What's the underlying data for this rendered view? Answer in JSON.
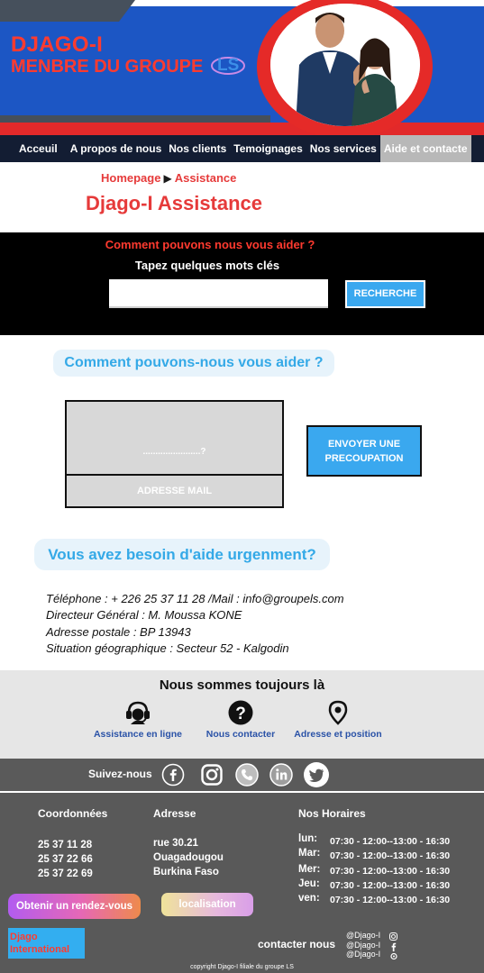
{
  "header": {
    "brand_line1": "DJAGO-I",
    "brand_line2": "MENBRE DU GROUPE",
    "logo_text": "LS",
    "colors": {
      "banner": "#1c56c4",
      "brand_red": "#ff3b2f",
      "accent_red": "#e2292a"
    }
  },
  "nav": {
    "items": [
      {
        "label": "Acceuil"
      },
      {
        "label": "A propos de nous"
      },
      {
        "label": "Nos clients"
      },
      {
        "label": "Temoignages"
      },
      {
        "label": "Nos services"
      },
      {
        "label": "Aide et contacte"
      }
    ],
    "active_index": 5
  },
  "breadcrumb": {
    "home": "Homepage",
    "current": "Assistance"
  },
  "page_title": "Djago-I Assistance",
  "search": {
    "question": "Comment pouvons nous vous aider ?",
    "hint": "Tapez quelques mots clés",
    "input_value": "",
    "button_label": "RECHERCHE"
  },
  "help": {
    "heading": "Comment pouvons-nous vous aider ?",
    "message_placeholder": ".......................?",
    "email_placeholder": "ADRESSE MAIL",
    "send_button": "ENVOYER UNE PRECOUPATION"
  },
  "urgent": {
    "heading": "Vous avez besoin d'aide urgenment?",
    "lines": [
      "Téléphone : + 226 25 37 11 28 /Mail : info@groupels.com",
      "Directeur Général : M. Moussa KONE",
      "Adresse postale : BP 13943",
      "Situation géographique : Secteur 52 - Kalgodin"
    ]
  },
  "always": {
    "title": "Nous sommes toujours là",
    "items": [
      {
        "label": "Assistance en ligne",
        "icon": "headset-icon"
      },
      {
        "label": "Nous contacter",
        "icon": "question-icon"
      },
      {
        "label": "Adresse et position",
        "icon": "map-pin-icon"
      }
    ]
  },
  "follow": {
    "label": "Suivez-nous",
    "icons": [
      "facebook-icon",
      "instagram-icon",
      "phone-icon",
      "linkedin-icon",
      "twitter-icon"
    ]
  },
  "footer": {
    "coords_title": "Coordonnées",
    "coords": [
      "25 37 11 28",
      "25 37 22 66",
      "25 37 22 69"
    ],
    "address_title": "Adresse",
    "address": [
      "rue 30.21",
      "Ouagadougou",
      "Burkina Faso"
    ],
    "hours_title": "Nos Horaires",
    "hours": [
      {
        "day": "lun:",
        "time": "07:30 - 12:00--13:00 - 16:30"
      },
      {
        "day": "Mar:",
        "time": "07:30 - 12:00--13:00 - 16:30"
      },
      {
        "day": "Mer:",
        "time": "07:30 - 12:00--13:00 - 16:30"
      },
      {
        "day": "Jeu:",
        "time": "07:30 - 12:00--13:00 - 16:30"
      },
      {
        "day": "ven:",
        "time": "07:30 - 12:00--13:00 - 16:30"
      }
    ],
    "rdv_button": "Obtenir un rendez-vous",
    "loc_button": "localisation",
    "brand_box_line1": "Djago",
    "brand_box_line2": "International",
    "contact_label": "contacter nous",
    "handles": [
      "@Djago-I",
      "@Djago-I",
      "@Djago-I"
    ],
    "copyright": "copyright Djago-I filiale du groupe LS"
  }
}
